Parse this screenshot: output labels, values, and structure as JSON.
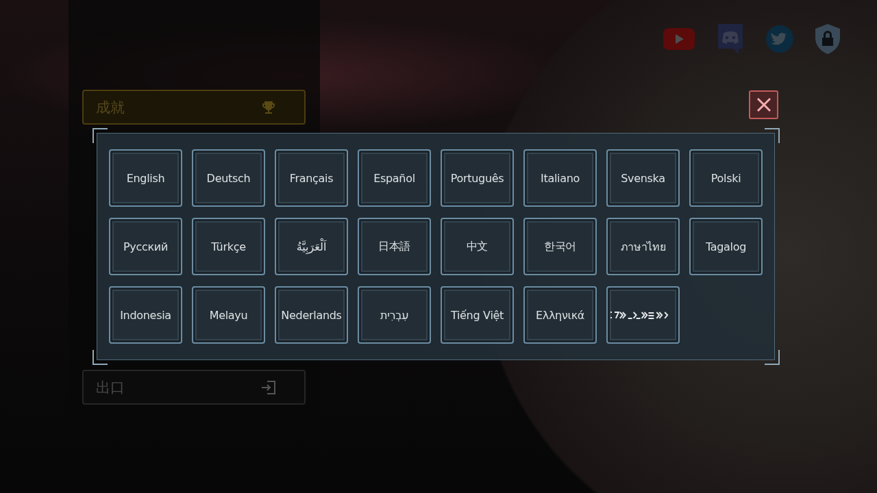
{
  "menu": {
    "items": [
      {
        "label": "成就",
        "kind": "achievements"
      },
      {
        "label": "出口",
        "kind": "exit"
      }
    ]
  },
  "language_dialog": {
    "languages": [
      {
        "label": "English",
        "kind": "text"
      },
      {
        "label": "Deutsch",
        "kind": "text"
      },
      {
        "label": "Français",
        "kind": "text"
      },
      {
        "label": "Español",
        "kind": "text"
      },
      {
        "label": "Português",
        "kind": "text"
      },
      {
        "label": "Italiano",
        "kind": "text"
      },
      {
        "label": "Svenska",
        "kind": "text"
      },
      {
        "label": "Polski",
        "kind": "text"
      },
      {
        "label": "Русский",
        "kind": "text"
      },
      {
        "label": "Türkçe",
        "kind": "text"
      },
      {
        "label": "اَلْعَرَبِيَّةُ",
        "kind": "text"
      },
      {
        "label": "日本語",
        "kind": "text"
      },
      {
        "label": "中文",
        "kind": "text"
      },
      {
        "label": "한국어",
        "kind": "text"
      },
      {
        "label": "ภาษาไทย",
        "kind": "text"
      },
      {
        "label": "Tagalog",
        "kind": "text"
      },
      {
        "label": "Indonesia",
        "kind": "text"
      },
      {
        "label": "Melayu",
        "kind": "text"
      },
      {
        "label": "Nederlands",
        "kind": "text"
      },
      {
        "label": "עִבְרִית",
        "kind": "text"
      },
      {
        "label": "Tiếng Việt",
        "kind": "text"
      },
      {
        "label": "Ελληνικά",
        "kind": "text"
      },
      {
        "kind": "glyph"
      }
    ]
  }
}
